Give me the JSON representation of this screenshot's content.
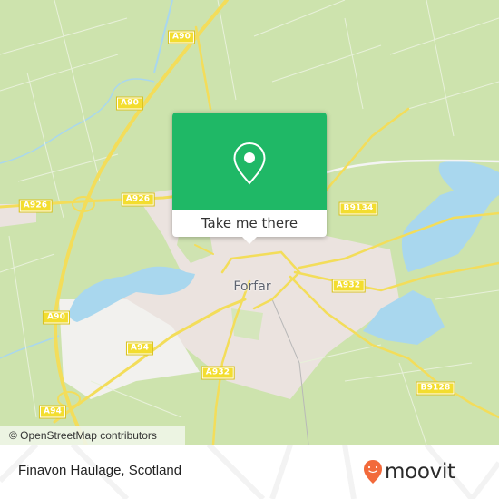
{
  "map": {
    "town_label": "Forfar",
    "road_labels": [
      {
        "id": "a90-top",
        "text": "A90"
      },
      {
        "id": "a90-mid",
        "text": "A90"
      },
      {
        "id": "a926-left",
        "text": "A926"
      },
      {
        "id": "a926-mid",
        "text": "A926"
      },
      {
        "id": "b9134",
        "text": "B9134"
      },
      {
        "id": "a932-east",
        "text": "A932"
      },
      {
        "id": "a90-lower",
        "text": "A90"
      },
      {
        "id": "a94-mid",
        "text": "A94"
      },
      {
        "id": "a932-south",
        "text": "A932"
      },
      {
        "id": "b9128",
        "text": "B9128"
      },
      {
        "id": "a94-lower",
        "text": "A94"
      }
    ],
    "attribution": "© OpenStreetMap contributors",
    "colors": {
      "land": "#cde3ad",
      "water": "#a9d7ee",
      "urban": "#ebe3df",
      "road": "#f3dd5a",
      "popup_green": "#1fb866"
    }
  },
  "popup": {
    "icon": "map-pin-icon",
    "action_label": "Take me there"
  },
  "footer": {
    "place_name": "Finavon Haulage, Scotland",
    "brand": "moovit",
    "brand_icon": "moovit-pin-logo-icon",
    "brand_color": "#f26a3b"
  }
}
